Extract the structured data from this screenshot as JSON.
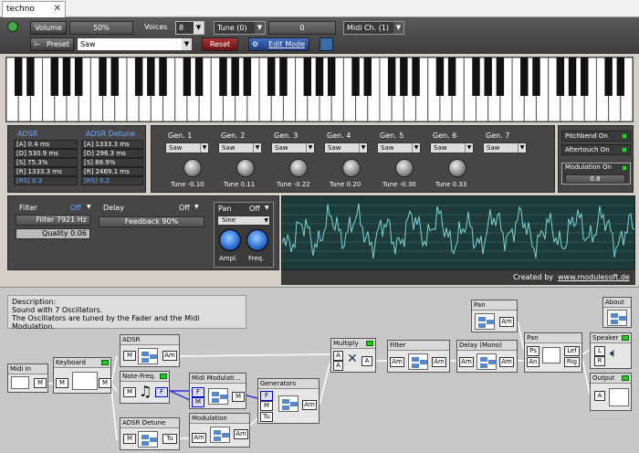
{
  "tab": {
    "title": "techno"
  },
  "toolbar": {
    "volume_label": "Volume",
    "volume_value": "50%",
    "voices_label": "Voices",
    "voices_value": "8",
    "tune_select": "Tune (0)",
    "tune_value": "0",
    "midi_select": "Midi Ch. (1)",
    "preset_label": "Preset",
    "preset_value": "Saw",
    "reset_label": "Reset",
    "edit_mode_label": "Edit Mode"
  },
  "adsr": {
    "title": "ADSR",
    "rows": [
      "[A]  0.4 ms",
      "[D]  530.9 ms",
      "[S]  75.3%",
      "[R]  1333.3 ms"
    ],
    "rs": "[RS]  0.3"
  },
  "adsr_detune": {
    "title": "ADSR Detune",
    "rows": [
      "[A]  1333.3 ms",
      "[D]  296.3 ms",
      "[S]  88.9%",
      "[R]  2469.1 ms"
    ],
    "rs": "[RS]  0.2"
  },
  "generators": [
    {
      "label": "Gen. 1",
      "wave": "Saw",
      "tune": "Tune -0.10"
    },
    {
      "label": "Gen. 2",
      "wave": "Saw",
      "tune": "Tune 0.11"
    },
    {
      "label": "Gen. 3",
      "wave": "Saw",
      "tune": "Tune -0.22"
    },
    {
      "label": "Gen. 4",
      "wave": "Saw",
      "tune": "Tune 0.20"
    },
    {
      "label": "Gen. 5",
      "wave": "Saw",
      "tune": "Tune -0.30"
    },
    {
      "label": "Gen. 6",
      "wave": "Saw",
      "tune": "Tune 0.33"
    },
    {
      "label": "Gen. 7",
      "wave": "Saw",
      "tune": ""
    }
  ],
  "right_panel": {
    "pitchbend": "Pitchbend On",
    "aftertouch": "Aftertouch On",
    "modulation": "Modulation On",
    "mod_value": "0.8"
  },
  "filter": {
    "title": "Filter",
    "state": "Off",
    "freq": "Filter 7921 Hz",
    "quality": "Quality 0.06"
  },
  "delay": {
    "title": "Delay",
    "state": "Off",
    "feedback": "Feedback 90%"
  },
  "pan": {
    "title": "Pan",
    "state": "Off",
    "wave": "Sine",
    "ampl": "Ampl.",
    "freq": "Freq."
  },
  "credit": {
    "text": "Created by",
    "link": "www.modulesoft.de"
  },
  "description": {
    "lines": [
      "Description:",
      "Sound with 7 Oscillators.",
      "The Oscillators are tuned by the Fader and the Midi Modulation."
    ]
  },
  "nodes": {
    "midi_in": "Midi In",
    "keyboard": "Keyboard",
    "adsr": "ADSR",
    "note_freq": "Note-Freq.",
    "adsr_detune": "ADSR Detune",
    "midi_mod": "Midi Modulati...",
    "modulation": "Modulation",
    "generators": "Generators",
    "multiply": "Multiply",
    "filter": "Filter",
    "delay": "Delay (Mono)",
    "pan_top": "Pan",
    "pan": "Pan",
    "speaker": "Speaker",
    "about": "About",
    "output": "Output"
  },
  "ports": {
    "M": "M",
    "Am": "Am",
    "F": "F",
    "Tu": "Tu",
    "A": "A",
    "Ps": "Ps",
    "An": "An",
    "Lef": "Lef",
    "Rig": "Rig",
    "L": "L",
    "R": "R"
  },
  "colors": {
    "accent": "#6ea8ff",
    "led": "#33cc33",
    "wave": "#7fd3d3"
  }
}
